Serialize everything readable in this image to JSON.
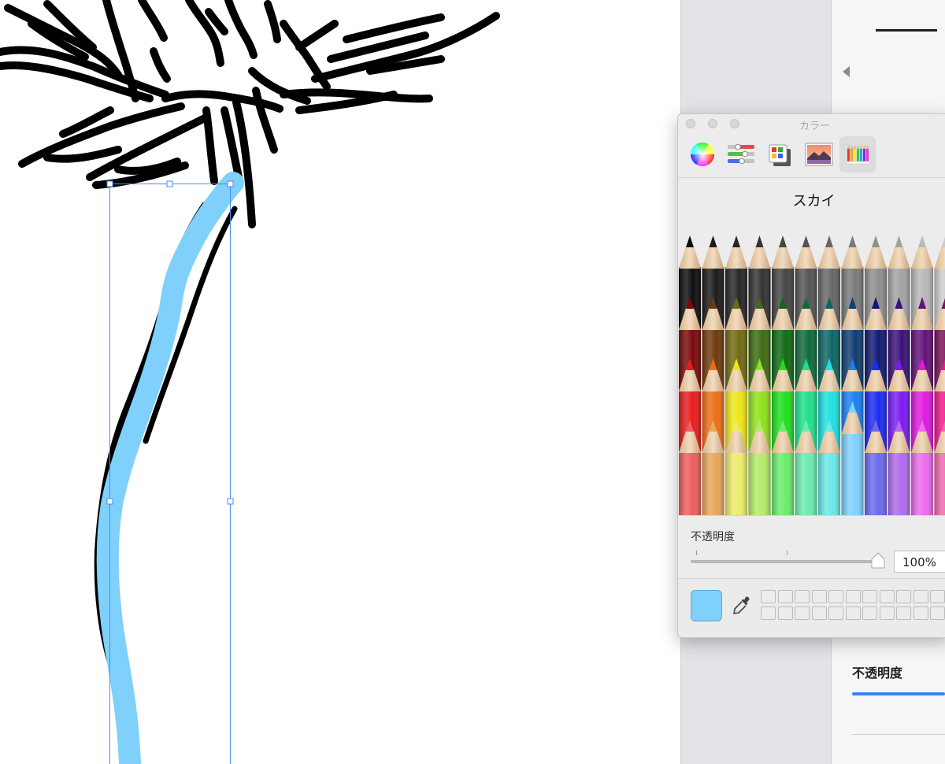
{
  "color_panel": {
    "title": "カラー",
    "modes": [
      {
        "name": "color-wheel-icon"
      },
      {
        "name": "color-sliders-icon"
      },
      {
        "name": "color-palettes-icon"
      },
      {
        "name": "image-palettes-icon"
      },
      {
        "name": "pencils-icon"
      }
    ],
    "selected_mode": "pencils",
    "selected_color_name": "スカイ",
    "opacity": {
      "label": "不透明度",
      "value": "100%"
    },
    "current_color": "#7fd0fb",
    "pencils": {
      "rows": [
        [
          "#0e0e0e",
          "#1b1b1b",
          "#262626",
          "#333333",
          "#444444",
          "#545454",
          "#666666",
          "#7a7a7a",
          "#8e8e8e",
          "#a3a3a3",
          "#b8b8b8",
          "#cccccc"
        ],
        [
          "#7a0a0a",
          "#6e3a0c",
          "#6f6a10",
          "#3d6c12",
          "#0f6a14",
          "#0f6a3a",
          "#0f6464",
          "#0f3e70",
          "#101a73",
          "#3a117a",
          "#65117a",
          "#7a1158"
        ],
        [
          "#e81c1c",
          "#ee6d14",
          "#efe617",
          "#8ee21a",
          "#1fe01f",
          "#1fdf8c",
          "#1fe0e0",
          "#1a7ff0",
          "#1a2af0",
          "#7a1af0",
          "#e01ae0",
          "#ee1a8c"
        ],
        [
          "#ee5f5f",
          "#e8a75a",
          "#ecec6a",
          "#b4ec6a",
          "#6aec6a",
          "#6aecb0",
          "#6ae8e8",
          "#7fd0fb",
          "#6a6aee",
          "#b06aee",
          "#ee6aee",
          "#ee6ab0"
        ]
      ],
      "selected": {
        "row": 3,
        "col": 7
      }
    }
  },
  "inspector": {
    "opacity_label": "不透明度"
  },
  "canvas": {
    "stroke_color": "#7fd0fb",
    "selection_color": "#4c8af0"
  }
}
